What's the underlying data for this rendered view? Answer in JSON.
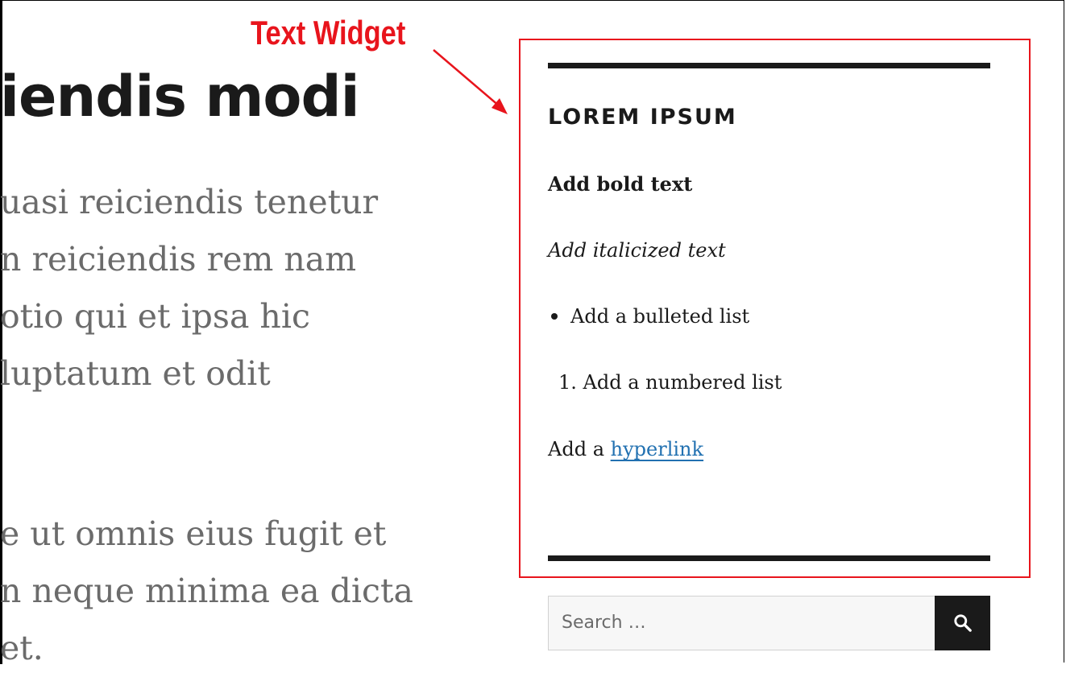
{
  "main": {
    "title": "iendis modi",
    "paragraph1": [
      "uasi reiciendis tenetur",
      "n reiciendis rem nam",
      "otio qui et ipsa hic",
      "luptatum et odit"
    ],
    "paragraph2": [
      "e ut omnis eius fugit et",
      "n neque minima ea dicta",
      "et."
    ]
  },
  "annotation": {
    "label": "Text Widget",
    "color": "#e8141c"
  },
  "widget": {
    "title": "LOREM IPSUM",
    "bold_text": "Add bold text",
    "italic_text": "Add italicized text",
    "bullet_item": "Add a bulleted list",
    "numbered_marker": "1.",
    "numbered_item": "Add a numbered list",
    "link_prefix": "Add a",
    "link_text": "hyperlink",
    "link_color": "#2271b1"
  },
  "search": {
    "placeholder": "Search …",
    "button_icon": "search-icon"
  }
}
